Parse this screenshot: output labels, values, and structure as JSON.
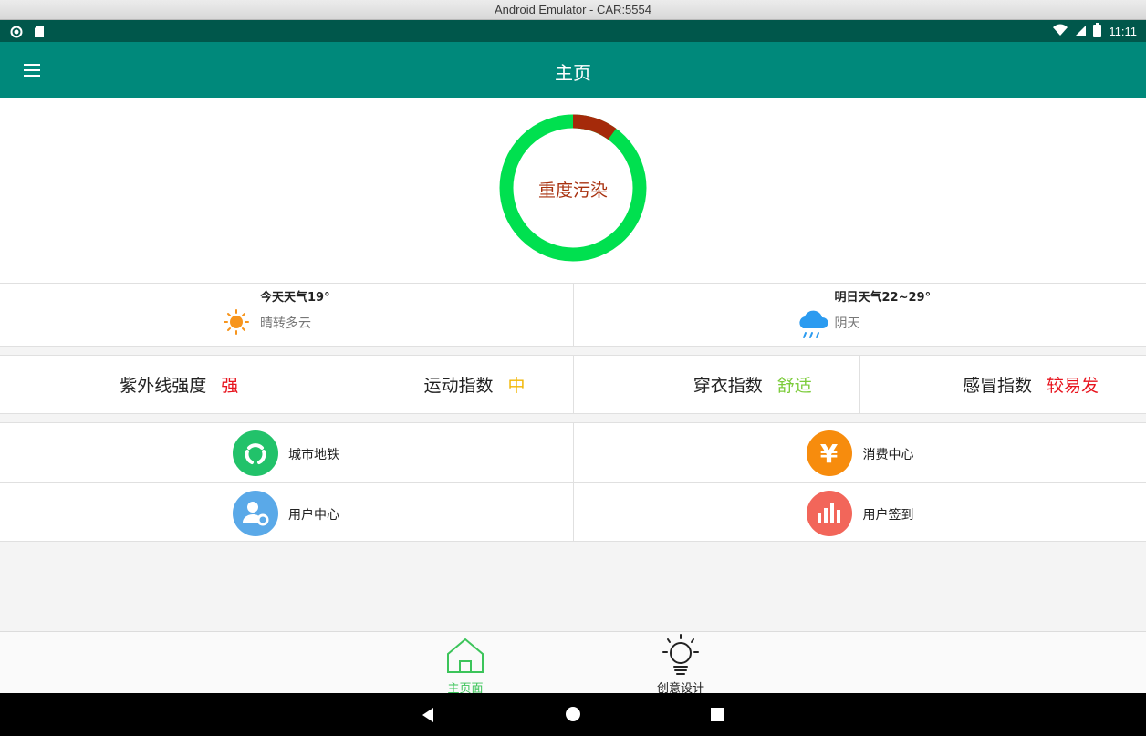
{
  "window": {
    "title": "Android Emulator - CAR:5554"
  },
  "status_bar": {
    "time": "11:11"
  },
  "app_bar": {
    "title": "主页"
  },
  "pollution": {
    "label": "重度污染",
    "level_fraction": 0.1,
    "ring_color": "#00e04f",
    "level_color": "#a52a0a"
  },
  "weather": {
    "today": {
      "title": "今天天气19°",
      "desc": "晴转多云",
      "icon": "sun-icon"
    },
    "tomorrow": {
      "title": "明日天气22~29°",
      "desc": "阴天",
      "icon": "rain-cloud-icon"
    }
  },
  "indices": [
    {
      "name": "紫外线强度",
      "level": "强",
      "color": "#e8141e"
    },
    {
      "name": "运动指数",
      "level": "中",
      "color": "#f2b705"
    },
    {
      "name": "穿衣指数",
      "level": "舒适",
      "color": "#7dcc3c"
    },
    {
      "name": "感冒指数",
      "level": "较易发",
      "color": "#e8141e"
    }
  ],
  "services": [
    {
      "label": "城市地铁",
      "icon": "metro-icon",
      "color": "#22c26a"
    },
    {
      "label": "消费中心",
      "icon": "yen-icon",
      "color": "#f78c0d"
    },
    {
      "label": "用户中心",
      "icon": "user-settings-icon",
      "color": "#5aa9e8"
    },
    {
      "label": "用户签到",
      "icon": "bar-chart-icon",
      "color": "#f2665a"
    }
  ],
  "bottom_nav": [
    {
      "label": "主页面",
      "icon": "home-icon",
      "active": true,
      "color": "#3cc45a"
    },
    {
      "label": "创意设计",
      "icon": "lightbulb-icon",
      "active": false,
      "color": "#222222"
    }
  ]
}
